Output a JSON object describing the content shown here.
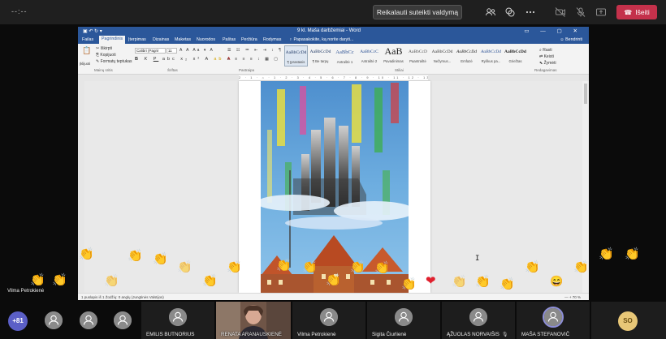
{
  "meeting": {
    "timer": "--:--",
    "request_control_label": "Reikalauti suteikti valdymą",
    "leave_label": "Išeiti",
    "controls": [
      "people-icon",
      "chat-icon",
      "more-icon",
      "camera-off-icon",
      "mic-off-icon",
      "share-icon"
    ]
  },
  "word": {
    "window_title": "9 kl. Maša darbžemiai - Word",
    "tabs": [
      "Failas",
      "Pagrindinis",
      "Įterpimas",
      "Dizainas",
      "Maketas",
      "Nuorodos",
      "Paštas",
      "Peržiūra",
      "Rodymas"
    ],
    "active_tab": "Pagrindinis",
    "tell_me": "Papasakokite, ką norite daryti...",
    "share_label": "Bendrinti",
    "clipboard": {
      "paste": "Įklijuoti",
      "cut": "Iškirpti",
      "copy": "Kopijuoti",
      "format_painter": "Formatų teptukas",
      "group": "Mainų sritis"
    },
    "font": {
      "name": "Calibri (Pagrir",
      "size": "11",
      "group": "Šriftas"
    },
    "paragraph_group": "Pastraipa",
    "styles_group": "Stiliai",
    "styles": [
      {
        "sample": "AaBbCcDd",
        "name": "¶ Įprastasis"
      },
      {
        "sample": "AaBbCcDd",
        "name": "¶ Be tarpų"
      },
      {
        "sample": "AaBbCc",
        "name": "Antraštė 1"
      },
      {
        "sample": "AaBbCcC",
        "name": "Antraštė 2"
      },
      {
        "sample": "AaB",
        "name": "Pavadinimas"
      },
      {
        "sample": "AaBbCcD",
        "name": "Paantraštė"
      },
      {
        "sample": "AaBbCcDd",
        "name": "Nežymus..."
      },
      {
        "sample": "AaBbCcDd",
        "name": "Emfazė"
      },
      {
        "sample": "AaBbCcDd",
        "name": "Ryškus pa..."
      },
      {
        "sample": "AaBbCcDd",
        "name": "Griežtas"
      }
    ],
    "editing": {
      "find": "Rasti",
      "replace": "Keisti",
      "select": "Žymėti",
      "group": "Redagavimas"
    },
    "ruler_text": "2 · 1 · ⌂ · 1 · 2 · 3 · 4 · 5 · 6 · 7 · 8 · 9 · 10 · 11 · 12 · 13 · 14 · 15 · 16 · 17 · 18 · 19",
    "status_left": "1 puslapis iš 1   Žodžių: 0   anglų (Jungtinės Valstijos)",
    "status_right": "— + 70 %"
  },
  "presenter": "Vilma Petrokienė",
  "participants": {
    "overflow": "+81",
    "tiles": [
      {
        "name": "",
        "muted": false
      },
      {
        "name": "",
        "muted": false
      },
      {
        "name": "",
        "muted": false
      },
      {
        "name": "EMILIS BUTNORIUS",
        "muted": false
      },
      {
        "name": "RENATA ARANAUSKIENĖ",
        "muted": false
      },
      {
        "name": "Vilma Petrokienė",
        "muted": false
      },
      {
        "name": "Sigita Čiurlienė",
        "muted": false
      },
      {
        "name": "ĄŽUOLAS NORVAIŠIS",
        "muted": true
      },
      {
        "name": "MAŠA STEFANOVIČ",
        "muted": false
      }
    ],
    "initials_tile": "SO"
  },
  "colors": {
    "leave": "#c4314b",
    "word_blue": "#2b579a",
    "overflow": "#5b5fc7",
    "avatar_so": "#e8c777"
  }
}
